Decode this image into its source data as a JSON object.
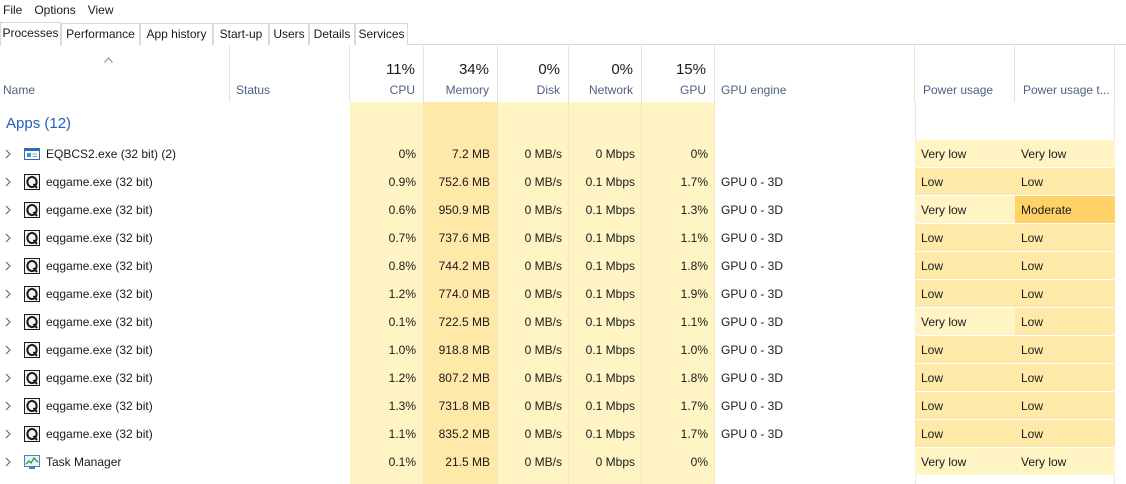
{
  "menu": [
    "File",
    "Options",
    "View"
  ],
  "tabs": [
    "Processes",
    "Performance",
    "App history",
    "Start-up",
    "Users",
    "Details",
    "Services"
  ],
  "header": {
    "name": "Name",
    "status": "Status",
    "cpu": {
      "pct": "11%",
      "label": "CPU"
    },
    "memory": {
      "pct": "34%",
      "label": "Memory"
    },
    "disk": {
      "pct": "0%",
      "label": "Disk"
    },
    "network": {
      "pct": "0%",
      "label": "Network"
    },
    "gpu": {
      "pct": "15%",
      "label": "GPU"
    },
    "gpu_engine": "GPU engine",
    "power": "Power usage",
    "power_trend": "Power usage t..."
  },
  "group": "Apps (12)",
  "rows": [
    {
      "name": "EQBCS2.exe (32 bit) (2)",
      "icon": "window-app-icon",
      "cpu": "0%",
      "memory": "7.2 MB",
      "disk": "0 MB/s",
      "network": "0 Mbps",
      "gpu": "0%",
      "gpu_engine": "",
      "power": "Very low",
      "power_trend": "Very low"
    },
    {
      "name": "eqgame.exe (32 bit)",
      "icon": "eqgame-icon",
      "cpu": "0.9%",
      "memory": "752.6 MB",
      "disk": "0 MB/s",
      "network": "0.1 Mbps",
      "gpu": "1.7%",
      "gpu_engine": "GPU 0 - 3D",
      "power": "Low",
      "power_trend": "Low"
    },
    {
      "name": "eqgame.exe (32 bit)",
      "icon": "eqgame-icon",
      "cpu": "0.6%",
      "memory": "950.9 MB",
      "disk": "0 MB/s",
      "network": "0.1 Mbps",
      "gpu": "1.3%",
      "gpu_engine": "GPU 0 - 3D",
      "power": "Very low",
      "power_trend": "Moderate"
    },
    {
      "name": "eqgame.exe (32 bit)",
      "icon": "eqgame-icon",
      "cpu": "0.7%",
      "memory": "737.6 MB",
      "disk": "0 MB/s",
      "network": "0.1 Mbps",
      "gpu": "1.1%",
      "gpu_engine": "GPU 0 - 3D",
      "power": "Low",
      "power_trend": "Low"
    },
    {
      "name": "eqgame.exe (32 bit)",
      "icon": "eqgame-icon",
      "cpu": "0.8%",
      "memory": "744.2 MB",
      "disk": "0 MB/s",
      "network": "0.1 Mbps",
      "gpu": "1.8%",
      "gpu_engine": "GPU 0 - 3D",
      "power": "Low",
      "power_trend": "Low"
    },
    {
      "name": "eqgame.exe (32 bit)",
      "icon": "eqgame-icon",
      "cpu": "1.2%",
      "memory": "774.0 MB",
      "disk": "0 MB/s",
      "network": "0.1 Mbps",
      "gpu": "1.9%",
      "gpu_engine": "GPU 0 - 3D",
      "power": "Low",
      "power_trend": "Low"
    },
    {
      "name": "eqgame.exe (32 bit)",
      "icon": "eqgame-icon",
      "cpu": "0.1%",
      "memory": "722.5 MB",
      "disk": "0 MB/s",
      "network": "0.1 Mbps",
      "gpu": "1.1%",
      "gpu_engine": "GPU 0 - 3D",
      "power": "Very low",
      "power_trend": "Low"
    },
    {
      "name": "eqgame.exe (32 bit)",
      "icon": "eqgame-icon",
      "cpu": "1.0%",
      "memory": "918.8 MB",
      "disk": "0 MB/s",
      "network": "0.1 Mbps",
      "gpu": "1.0%",
      "gpu_engine": "GPU 0 - 3D",
      "power": "Low",
      "power_trend": "Low"
    },
    {
      "name": "eqgame.exe (32 bit)",
      "icon": "eqgame-icon",
      "cpu": "1.2%",
      "memory": "807.2 MB",
      "disk": "0 MB/s",
      "network": "0.1 Mbps",
      "gpu": "1.8%",
      "gpu_engine": "GPU 0 - 3D",
      "power": "Low",
      "power_trend": "Low"
    },
    {
      "name": "eqgame.exe (32 bit)",
      "icon": "eqgame-icon",
      "cpu": "1.3%",
      "memory": "731.8 MB",
      "disk": "0 MB/s",
      "network": "0.1 Mbps",
      "gpu": "1.7%",
      "gpu_engine": "GPU 0 - 3D",
      "power": "Low",
      "power_trend": "Low"
    },
    {
      "name": "eqgame.exe (32 bit)",
      "icon": "eqgame-icon",
      "cpu": "1.1%",
      "memory": "835.2 MB",
      "disk": "0 MB/s",
      "network": "0.1 Mbps",
      "gpu": "1.7%",
      "gpu_engine": "GPU 0 - 3D",
      "power": "Low",
      "power_trend": "Low"
    },
    {
      "name": "Task Manager",
      "icon": "task-manager-icon",
      "cpu": "0.1%",
      "memory": "21.5 MB",
      "disk": "0 MB/s",
      "network": "0 Mbps",
      "gpu": "0%",
      "gpu_engine": "",
      "power": "Very low",
      "power_trend": "Very low"
    }
  ],
  "colors": {
    "heat_light": "#fff4c4",
    "heat_medium": "#ffe9a8",
    "heat_moderate": "#ffd267",
    "group_title": "#1f5fb8",
    "header_label": "#4d6082"
  }
}
